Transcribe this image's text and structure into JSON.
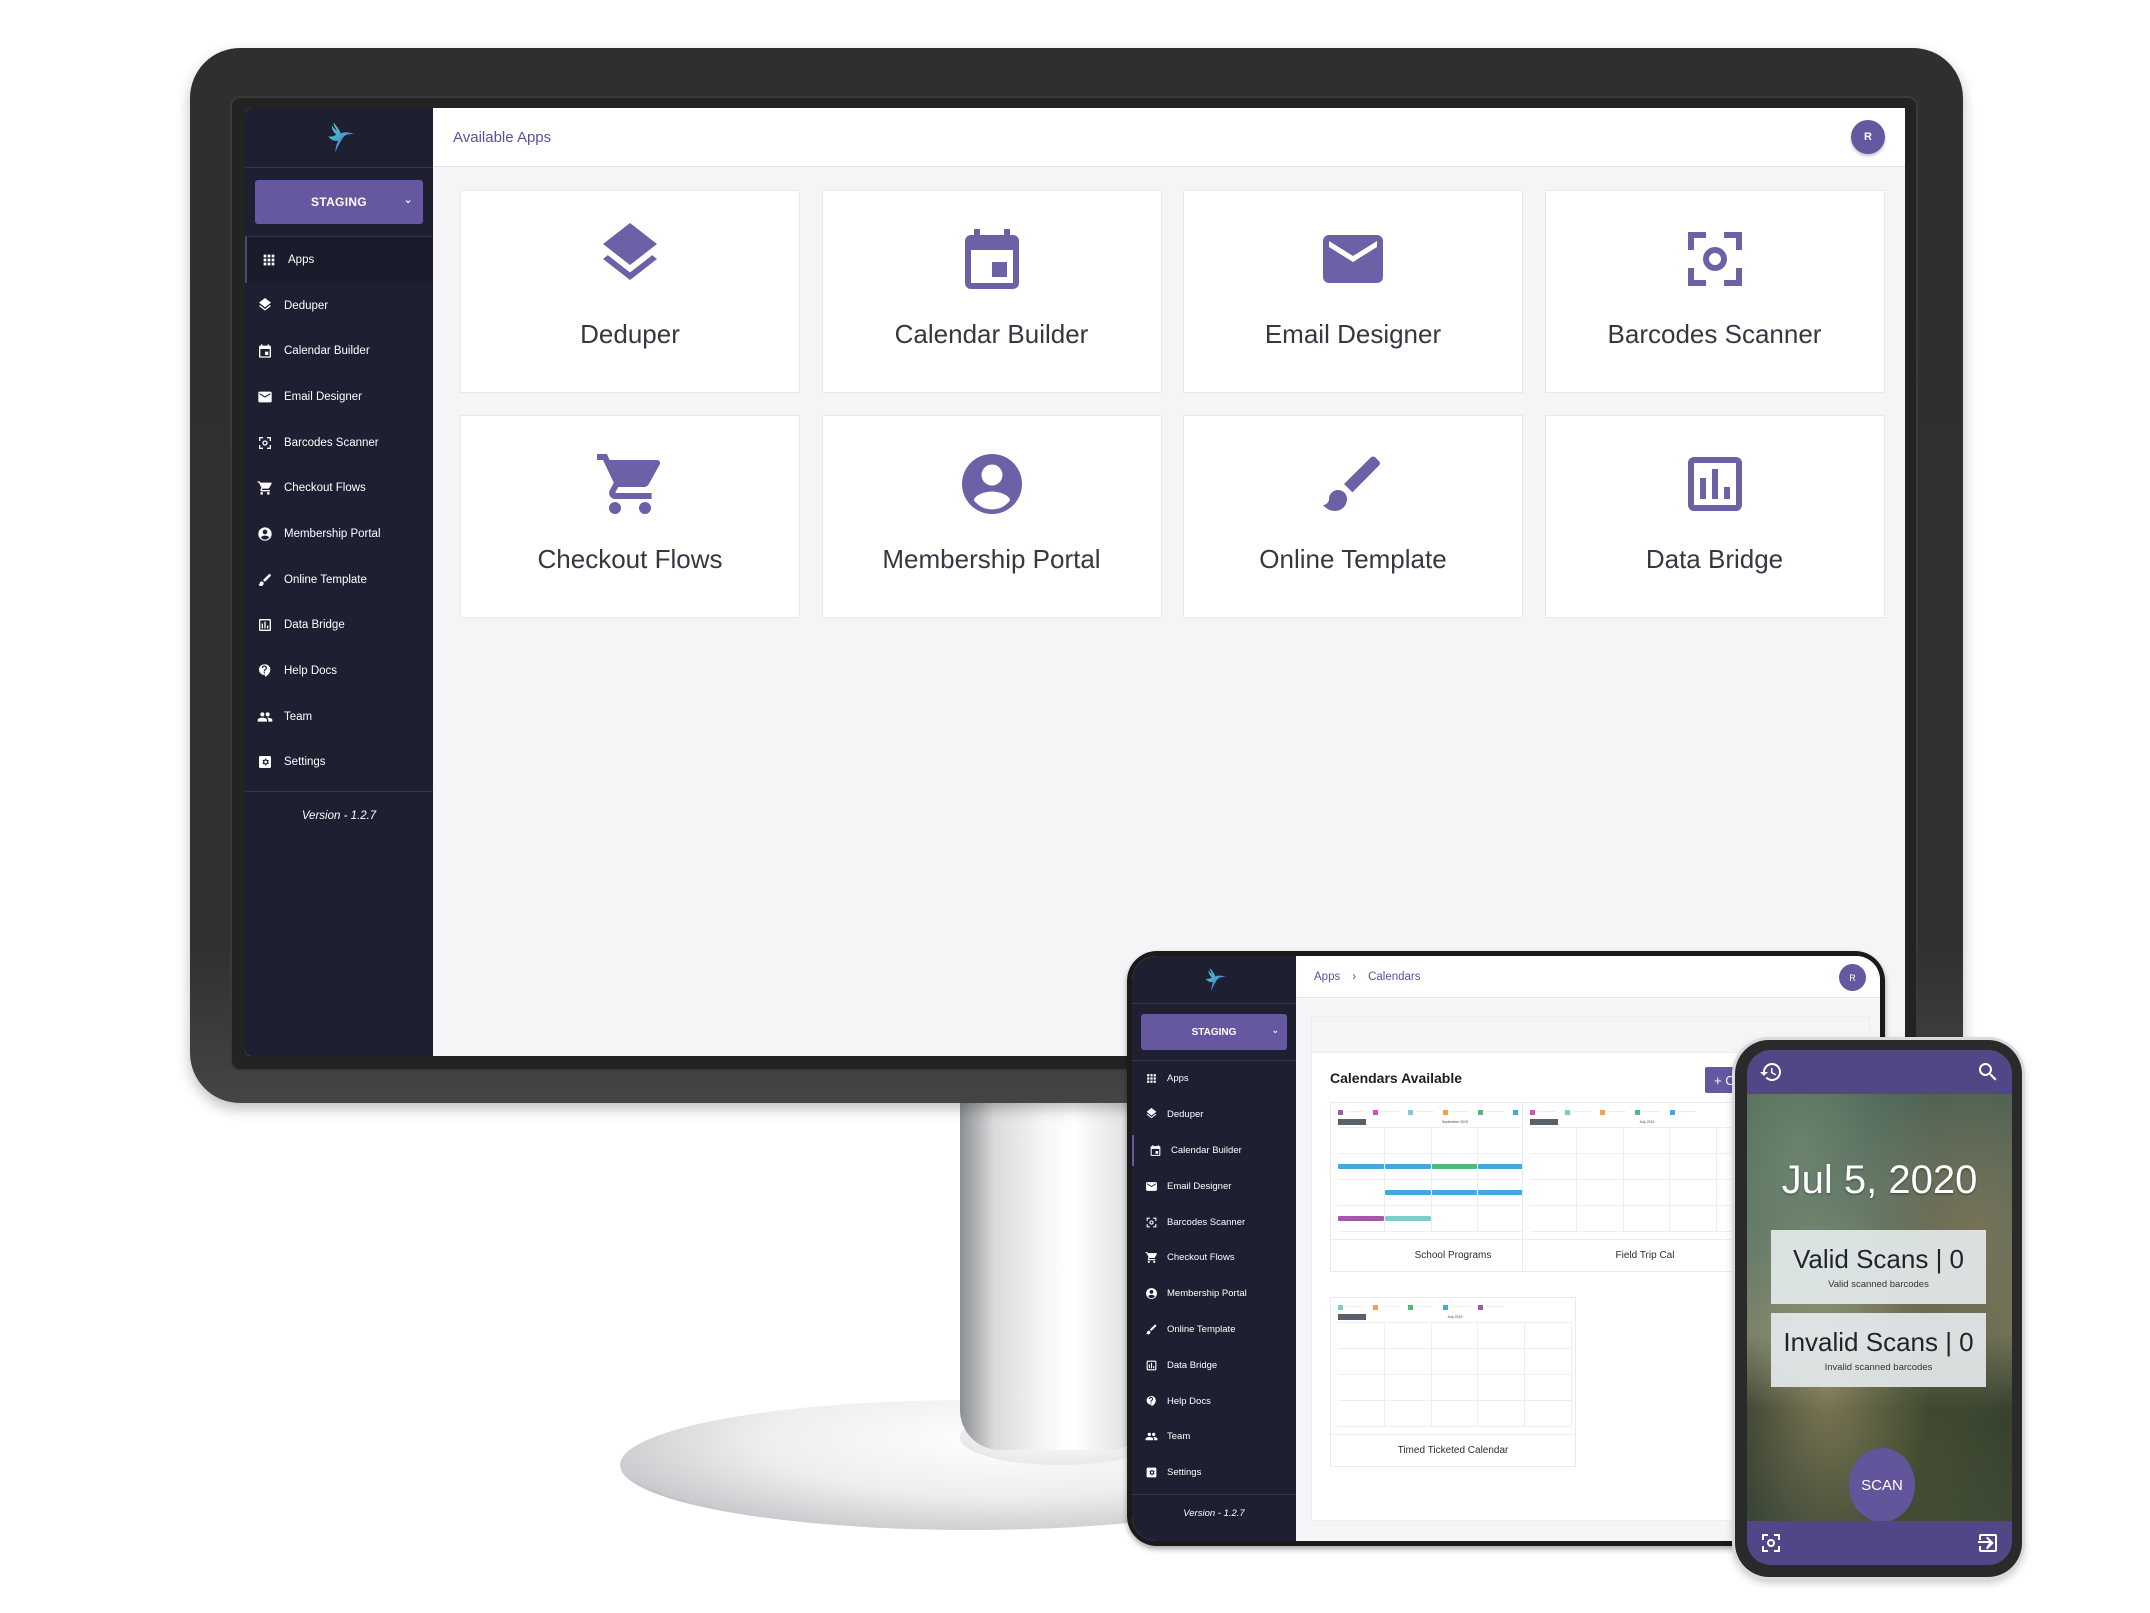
{
  "brand": {
    "accent": "#6558a0",
    "sidebar_bg": "#1e1f31",
    "icon_color": "#6c61a6"
  },
  "desktop": {
    "env_selector": {
      "value": "STAGING",
      "icon": "chevron-down-icon"
    },
    "header": {
      "title": "Available Apps",
      "avatar_initial": "R"
    },
    "sidebar": {
      "items": [
        {
          "label": "Apps",
          "icon": "apps-grid-icon",
          "active": true
        },
        {
          "label": "Deduper",
          "icon": "layers-icon"
        },
        {
          "label": "Calendar Builder",
          "icon": "calendar-icon"
        },
        {
          "label": "Email Designer",
          "icon": "mail-icon"
        },
        {
          "label": "Barcodes Scanner",
          "icon": "scan-icon"
        },
        {
          "label": "Checkout Flows",
          "icon": "cart-icon"
        },
        {
          "label": "Membership Portal",
          "icon": "account-circle-icon"
        },
        {
          "label": "Online Template",
          "icon": "brush-icon"
        },
        {
          "label": "Data Bridge",
          "icon": "chart-box-icon"
        },
        {
          "label": "Help Docs",
          "icon": "help-icon"
        },
        {
          "label": "Team",
          "icon": "team-icon"
        },
        {
          "label": "Settings",
          "icon": "settings-icon"
        }
      ],
      "version": "Version - 1.2.7"
    },
    "apps": [
      {
        "label": "Deduper",
        "icon": "layers-icon"
      },
      {
        "label": "Calendar Builder",
        "icon": "calendar-icon"
      },
      {
        "label": "Email Designer",
        "icon": "mail-icon"
      },
      {
        "label": "Barcodes Scanner",
        "icon": "scan-icon"
      },
      {
        "label": "Checkout Flows",
        "icon": "cart-icon"
      },
      {
        "label": "Membership Portal",
        "icon": "account-circle-icon"
      },
      {
        "label": "Online Template",
        "icon": "brush-icon"
      },
      {
        "label": "Data Bridge",
        "icon": "chart-box-icon"
      }
    ]
  },
  "tablet": {
    "env_selector": {
      "value": "STAGING"
    },
    "breadcrumb": {
      "root": "Apps",
      "separator": "›",
      "current": "Calendars"
    },
    "avatar_initial": "R",
    "sidebar": {
      "items": [
        {
          "label": "Apps"
        },
        {
          "label": "Deduper"
        },
        {
          "label": "Calendar Builder",
          "active": true
        },
        {
          "label": "Email Designer"
        },
        {
          "label": "Barcodes Scanner"
        },
        {
          "label": "Checkout Flows"
        },
        {
          "label": "Membership Portal"
        },
        {
          "label": "Online Template"
        },
        {
          "label": "Data Bridge"
        },
        {
          "label": "Help Docs"
        },
        {
          "label": "Team"
        },
        {
          "label": "Settings"
        }
      ],
      "version": "Version - 1.2.7"
    },
    "panel_title": "Calendars Available",
    "add_button": "+ C",
    "calendars": [
      {
        "name": "School Programs",
        "month": "September 2019"
      },
      {
        "name": "Field Trip Cal",
        "month": "July 2019"
      },
      {
        "name": "Timed Ticketed Calendar",
        "month": "July 2019"
      }
    ]
  },
  "phone": {
    "date": "Jul 5, 2020",
    "valid": {
      "title": "Valid Scans | 0",
      "subtitle": "Valid scanned barcodes",
      "count": 0
    },
    "invalid": {
      "title": "Invalid Scans | 0",
      "subtitle": "Invalid scanned barcodes",
      "count": 0
    },
    "scan_button": "SCAN",
    "top_icons": [
      "history-icon",
      "search-icon"
    ],
    "bottom_icons": [
      "scan-icon",
      "logout-icon"
    ]
  }
}
